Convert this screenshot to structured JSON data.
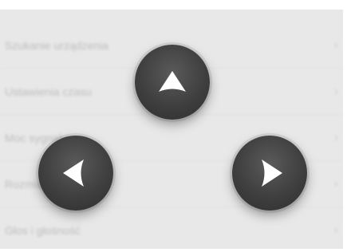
{
  "menu": {
    "items": [
      {
        "label": "Szukanie urządzenia",
        "chevron": "›"
      },
      {
        "label": "Ustawienia czasu",
        "chevron": "›"
      },
      {
        "label": "Moc sygnału",
        "chevron": "›"
      },
      {
        "label": "Rozmiar czcionki",
        "chevron": "›"
      },
      {
        "label": "Głos i głośność",
        "chevron": "›"
      }
    ]
  },
  "nav": {
    "up": {
      "icon": "arrow-up-icon"
    },
    "left": {
      "icon": "arrow-left-icon"
    },
    "right": {
      "icon": "arrow-right-icon"
    }
  },
  "colors": {
    "background": "#e8e8e8",
    "button": "#3f3f3f",
    "arrow": "#ffffff"
  }
}
